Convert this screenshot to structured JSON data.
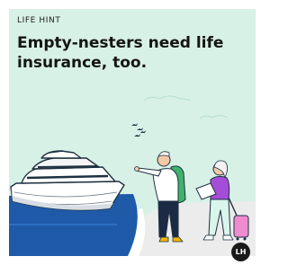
{
  "card": {
    "eyebrow": "LIFE HINT",
    "headline": "Empty-nesters need life insurance, too.",
    "badge": "LH"
  },
  "colors": {
    "background": "#d8f1e6",
    "sea": "#1f5aa8",
    "accent_green": "#3fb36a",
    "accent_purple": "#a44dd8",
    "accent_pink": "#f08bd0"
  },
  "icons": [
    "cruise-ship-icon",
    "flying-birds-icon",
    "traveler-man-icon",
    "traveler-woman-icon",
    "rolling-suitcase-icon"
  ]
}
